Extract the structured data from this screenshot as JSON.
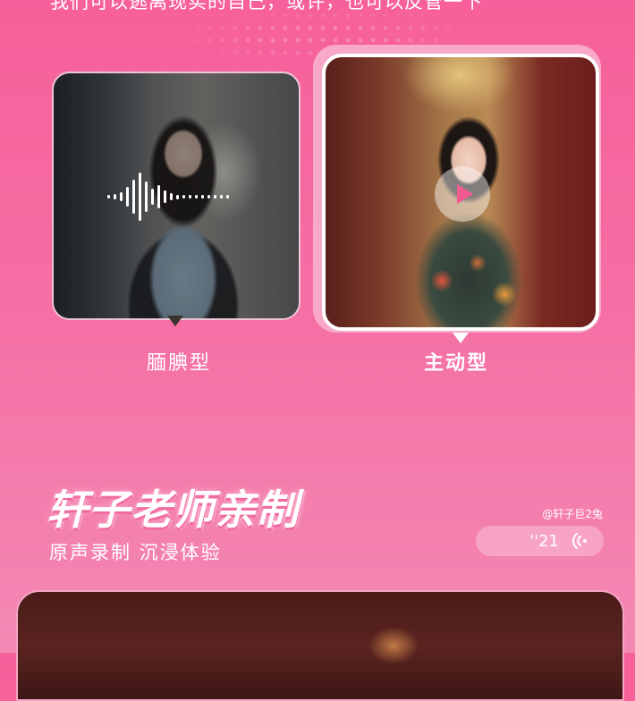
{
  "intro": {
    "text": "我们可以逃离现实的自己，或许，也可以反管一下"
  },
  "cards": [
    {
      "label": "腼腆型",
      "selected": false,
      "media": "voice-waveform-icon"
    },
    {
      "label": "主动型",
      "selected": true,
      "media": "play-icon"
    }
  ],
  "section": {
    "title": "轩子老师亲制",
    "subtitle": "原声录制  沉浸体验",
    "author": "@轩子巨2兔",
    "duration": "''21",
    "sound_icon": "sound-wave-icon"
  },
  "colors": {
    "background": "#f7609a",
    "accent": "#f45a92",
    "selected_frame": "#f7a9c7"
  }
}
